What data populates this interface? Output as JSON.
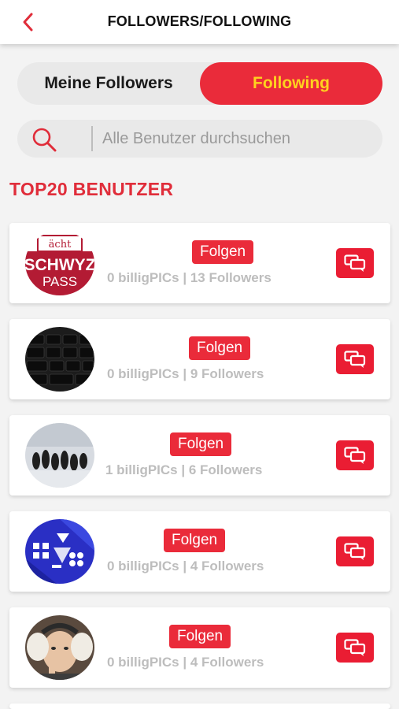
{
  "header": {
    "title": "FOLLOWERS/FOLLOWING",
    "back_icon": "chevron-left-icon"
  },
  "tabs": {
    "left_label": "Meine Followers",
    "right_label": "Following",
    "active": "Following"
  },
  "search": {
    "placeholder": "Alle Benutzer durchsuchen",
    "icon": "search-icon"
  },
  "section": {
    "title": "TOP20 BENUTZER"
  },
  "colors": {
    "accent": "#ea2b3a",
    "active_tab_text": "#ffd21f",
    "section_title": "#e02d3a",
    "stats_text": "#bdbdbd"
  },
  "users": [
    {
      "follow_label": "Folgen",
      "stats": "0 billigPICs | 13 Followers",
      "avatar_text_top": "ächt",
      "avatar_text_mid": "SCHWYZ",
      "avatar_text_bottom": "PASS"
    },
    {
      "follow_label": "Folgen",
      "stats": "0 billigPICs | 9 Followers"
    },
    {
      "follow_label": "Folgen",
      "stats": "1 billigPICs | 6 Followers"
    },
    {
      "follow_label": "Folgen",
      "stats": "0 billigPICs | 4 Followers"
    },
    {
      "follow_label": "Folgen",
      "stats": "0 billigPICs | 4 Followers"
    }
  ]
}
